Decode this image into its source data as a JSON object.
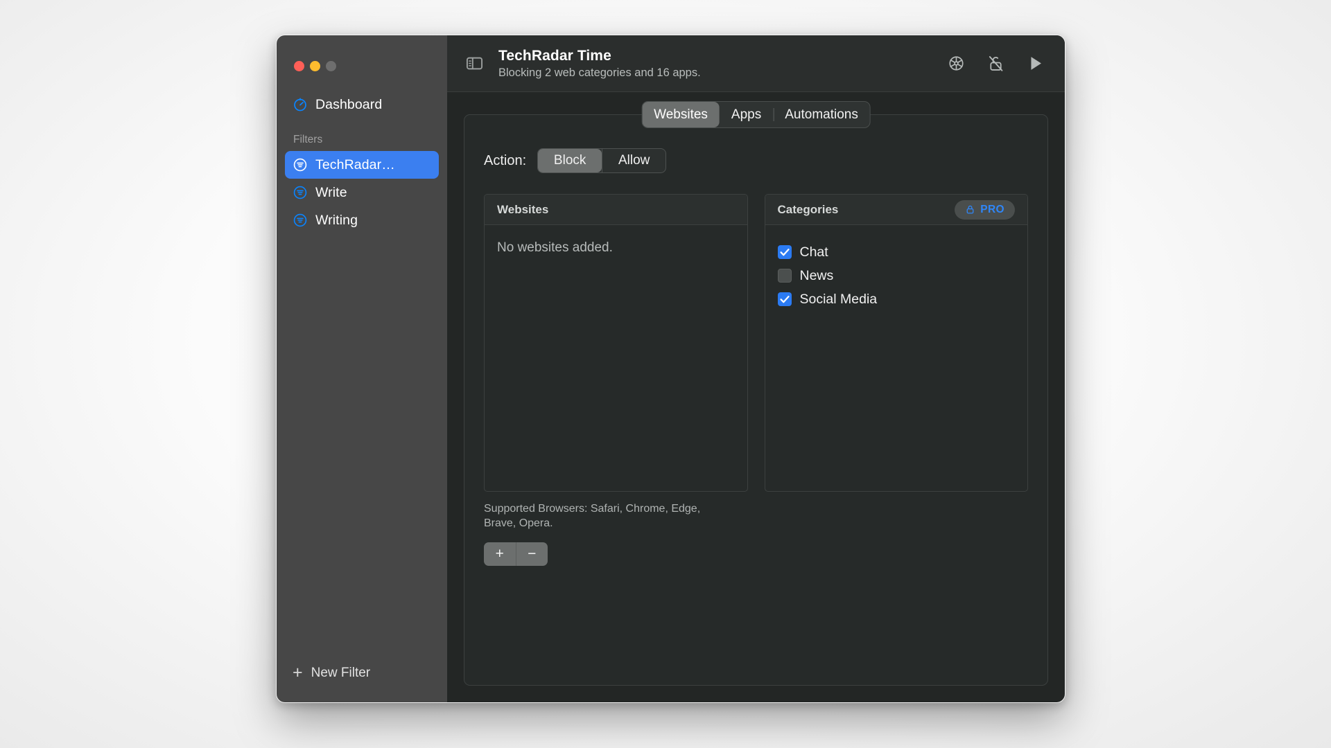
{
  "window": {
    "traffic_lights": [
      "close",
      "minimize",
      "zoom"
    ]
  },
  "sidebar": {
    "dashboard": {
      "label": "Dashboard",
      "icon": "timer-icon"
    },
    "section_label": "Filters",
    "items": [
      {
        "label": "TechRadar…",
        "icon": "filter-icon",
        "selected": true
      },
      {
        "label": "Write",
        "icon": "filter-icon",
        "selected": false
      },
      {
        "label": "Writing",
        "icon": "filter-icon",
        "selected": false
      }
    ],
    "new_filter": {
      "label": "New Filter",
      "icon": "plus-icon"
    }
  },
  "toolbar": {
    "sidebar_toggle_icon": "sidebar-toggle-icon",
    "title": "TechRadar Time",
    "subtitle": "Blocking 2 web categories and 16 apps.",
    "actions": [
      {
        "name": "settings-button",
        "icon": "gear-icon"
      },
      {
        "name": "unlock-button",
        "icon": "lock-slash-icon"
      },
      {
        "name": "start-button",
        "icon": "play-icon"
      }
    ]
  },
  "main": {
    "tabs": [
      {
        "label": "Websites",
        "active": true
      },
      {
        "label": "Apps",
        "active": false
      },
      {
        "label": "Automations",
        "active": false
      }
    ],
    "action": {
      "label": "Action:",
      "options": [
        {
          "label": "Block",
          "selected": true
        },
        {
          "label": "Allow",
          "selected": false
        }
      ]
    },
    "websites_panel": {
      "title": "Websites",
      "empty_text": "No websites added.",
      "footnote": "Supported Browsers: Safari, Chrome, Edge, Brave, Opera.",
      "add_label": "+",
      "remove_label": "−"
    },
    "categories_panel": {
      "title": "Categories",
      "pro_badge": {
        "label": "PRO",
        "icon": "lock-icon"
      },
      "items": [
        {
          "label": "Chat",
          "checked": true
        },
        {
          "label": "News",
          "checked": false
        },
        {
          "label": "Social Media",
          "checked": true
        }
      ]
    }
  },
  "colors": {
    "accent_blue": "#2b7bf3",
    "selected_row": "#3b7ff0",
    "sidebar_bg": "#474747",
    "main_bg": "#232625",
    "titlebar_bg": "#2b2e2d"
  }
}
